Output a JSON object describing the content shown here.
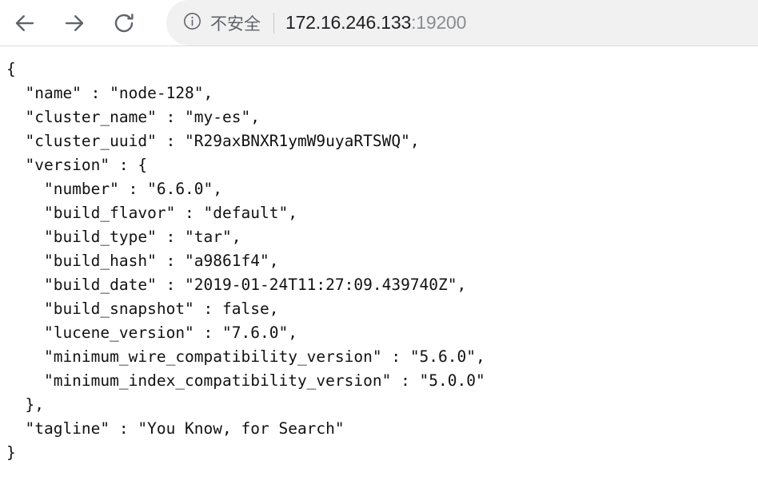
{
  "browser": {
    "back_button": "back-arrow",
    "forward_button": "forward-arrow",
    "reload_button": "reload",
    "security_icon": "info-circle-icon",
    "security_label": "不安全",
    "url_host": "172.16.246.133",
    "url_port": ":19200",
    "url_full": "172.16.246.133:19200",
    "colors": {
      "omnibox_background": "#f1f1f1",
      "toolbar_icon": "#5f6368",
      "security_text": "#5f6368",
      "url_host_text": "#202124",
      "url_port_text": "#8a8d91",
      "divider": "#dcdcdc"
    }
  },
  "content": {
    "text_color": "#121212",
    "background": "#ffffff",
    "json_body": "{\n  \"name\" : \"node-128\",\n  \"cluster_name\" : \"my-es\",\n  \"cluster_uuid\" : \"R29axBNXR1ymW9uyaRTSWQ\",\n  \"version\" : {\n    \"number\" : \"6.6.0\",\n    \"build_flavor\" : \"default\",\n    \"build_type\" : \"tar\",\n    \"build_hash\" : \"a9861f4\",\n    \"build_date\" : \"2019-01-24T11:27:09.439740Z\",\n    \"build_snapshot\" : false,\n    \"lucene_version\" : \"7.6.0\",\n    \"minimum_wire_compatibility_version\" : \"5.6.0\",\n    \"minimum_index_compatibility_version\" : \"5.0.0\"\n  },\n  \"tagline\" : \"You Know, for Search\"\n}",
    "fields": {
      "name": "node-128",
      "cluster_name": "my-es",
      "cluster_uuid": "R29axBNXR1ymW9uyaRTSWQ",
      "version_number": "6.6.0",
      "build_flavor": "default",
      "build_type": "tar",
      "build_hash": "a9861f4",
      "build_date": "2019-01-24T11:27:09.439740Z",
      "build_snapshot": "false",
      "lucene_version": "7.6.0",
      "minimum_wire_compatibility_version": "5.6.0",
      "minimum_index_compatibility_version": "5.0.0",
      "tagline": "You Know, for Search"
    }
  }
}
